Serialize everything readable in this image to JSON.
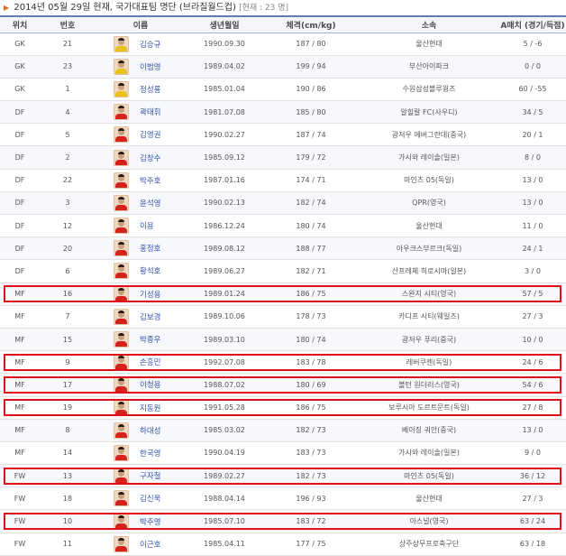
{
  "title": {
    "text": "2014년 05월 29일 현재, 국가대표팀 명단 (브라질월드컵)",
    "count": "[현재 : 23 명]"
  },
  "headers": [
    "위치",
    "번호",
    "이름",
    "생년월일",
    "체격(cm/kg)",
    "소속",
    "A매치 (경기/득점)"
  ],
  "rows": [
    {
      "pos": "GK",
      "num": "21",
      "name": "김승규",
      "birth": "1990.09.30",
      "body": "187 / 80",
      "club": "울산현대",
      "caps": "5 / -6",
      "gk": true
    },
    {
      "pos": "GK",
      "num": "23",
      "name": "이범영",
      "birth": "1989.04.02",
      "body": "199 / 94",
      "club": "부산아이파크",
      "caps": "0 / 0",
      "gk": true
    },
    {
      "pos": "GK",
      "num": "1",
      "name": "정성룡",
      "birth": "1985.01.04",
      "body": "190 / 86",
      "club": "수원삼성블루윙즈",
      "caps": "60 / -55",
      "gk": true
    },
    {
      "pos": "DF",
      "num": "4",
      "name": "곽태휘",
      "birth": "1981.07.08",
      "body": "185 / 80",
      "club": "알힐랄 FC(사우디)",
      "caps": "34 / 5"
    },
    {
      "pos": "DF",
      "num": "5",
      "name": "김영권",
      "birth": "1990.02.27",
      "body": "187 / 74",
      "club": "광저우 에버그란데(중국)",
      "caps": "20 / 1"
    },
    {
      "pos": "DF",
      "num": "2",
      "name": "김창수",
      "birth": "1985.09.12",
      "body": "179 / 72",
      "club": "가시와 레이솔(일본)",
      "caps": "8 / 0"
    },
    {
      "pos": "DF",
      "num": "22",
      "name": "박주호",
      "birth": "1987.01.16",
      "body": "174 / 71",
      "club": "마인츠 05(독일)",
      "caps": "13 / 0"
    },
    {
      "pos": "DF",
      "num": "3",
      "name": "윤석영",
      "birth": "1990.02.13",
      "body": "182 / 74",
      "club": "QPR(영국)",
      "caps": "13 / 0"
    },
    {
      "pos": "DF",
      "num": "12",
      "name": "이용",
      "birth": "1986.12.24",
      "body": "180 / 74",
      "club": "울산현대",
      "caps": "11 / 0"
    },
    {
      "pos": "DF",
      "num": "20",
      "name": "홍정호",
      "birth": "1989.08.12",
      "body": "188 / 77",
      "club": "아우크스부르크(독일)",
      "caps": "24 / 1"
    },
    {
      "pos": "DF",
      "num": "6",
      "name": "황석호",
      "birth": "1989.06.27",
      "body": "182 / 71",
      "club": "산프레체 히로시마(일본)",
      "caps": "3 / 0"
    },
    {
      "pos": "MF",
      "num": "16",
      "name": "기성용",
      "birth": "1989.01.24",
      "body": "186 / 75",
      "club": "스완지 시티(영국)",
      "caps": "57 / 5"
    },
    {
      "pos": "MF",
      "num": "7",
      "name": "김보경",
      "birth": "1989.10.06",
      "body": "178 / 73",
      "club": "카디프 시티(웨일즈)",
      "caps": "27 / 3"
    },
    {
      "pos": "MF",
      "num": "15",
      "name": "박종우",
      "birth": "1989.03.10",
      "body": "180 / 74",
      "club": "광저우 푸리(중국)",
      "caps": "10 / 0"
    },
    {
      "pos": "MF",
      "num": "9",
      "name": "손흥민",
      "birth": "1992.07.08",
      "body": "183 / 78",
      "club": "레버쿠젠(독일)",
      "caps": "24 / 6"
    },
    {
      "pos": "MF",
      "num": "17",
      "name": "이청용",
      "birth": "1988.07.02",
      "body": "180 / 69",
      "club": "볼턴 원더러스(영국)",
      "caps": "54 / 6"
    },
    {
      "pos": "MF",
      "num": "19",
      "name": "지동원",
      "birth": "1991.05.28",
      "body": "186 / 75",
      "club": "보루시아 도르트문트(독일)",
      "caps": "27 / 8"
    },
    {
      "pos": "MF",
      "num": "8",
      "name": "하대성",
      "birth": "1985.03.02",
      "body": "182 / 73",
      "club": "베이징 궈안(중국)",
      "caps": "13 / 0"
    },
    {
      "pos": "MF",
      "num": "14",
      "name": "한국영",
      "birth": "1990.04.19",
      "body": "183 / 73",
      "club": "가시와 레이솔(일본)",
      "caps": "9 / 0"
    },
    {
      "pos": "FW",
      "num": "13",
      "name": "구자철",
      "birth": "1989.02.27",
      "body": "182 / 73",
      "club": "마인츠 05(독일)",
      "caps": "36 / 12"
    },
    {
      "pos": "FW",
      "num": "18",
      "name": "김신욱",
      "birth": "1988.04.14",
      "body": "196 / 93",
      "club": "울산현대",
      "caps": "27 / 3"
    },
    {
      "pos": "FW",
      "num": "10",
      "name": "박주영",
      "birth": "1985.07.10",
      "body": "183 / 72",
      "club": "아스널(영국)",
      "caps": "63 / 24"
    },
    {
      "pos": "FW",
      "num": "11",
      "name": "이근호",
      "birth": "1985.04.11",
      "body": "177 / 75",
      "club": "상주상무프로축구단",
      "caps": "63 / 18"
    }
  ],
  "highlighted_rows": [
    11,
    14,
    15,
    16,
    19,
    21
  ],
  "colors": {
    "accent": "#5a7fb8",
    "highlight": "#e0101a",
    "link": "#3355aa",
    "marker": "#e07020"
  }
}
